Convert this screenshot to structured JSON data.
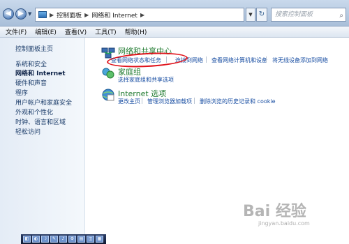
{
  "address": {
    "crumbs": [
      "控制面板",
      "网络和 Internet"
    ],
    "search_placeholder": "搜索控制面板"
  },
  "menu": [
    "文件(F)",
    "编辑(E)",
    "查看(V)",
    "工具(T)",
    "帮助(H)"
  ],
  "sidebar": {
    "items": [
      {
        "label": "控制面板主页",
        "active": false
      },
      {
        "label": "系统和安全",
        "active": false
      },
      {
        "label": "网络和 Internet",
        "active": true
      },
      {
        "label": "硬件和声音",
        "active": false
      },
      {
        "label": "程序",
        "active": false
      },
      {
        "label": "用户帐户和家庭安全",
        "active": false
      },
      {
        "label": "外观和个性化",
        "active": false
      },
      {
        "label": "时钟、语言和区域",
        "active": false
      },
      {
        "label": "轻松访问",
        "active": false
      }
    ]
  },
  "categories": [
    {
      "title": "网络和共享中心",
      "icon": "network-sharing-icon",
      "links": [
        "查看网络状态和任务",
        "连接到网络",
        "查看网络计算机和设备",
        "将无线设备添加到网络"
      ]
    },
    {
      "title": "家庭组",
      "icon": "homegroup-icon",
      "links": [
        "选择家庭组和共享选项"
      ]
    },
    {
      "title": "Internet 选项",
      "icon": "internet-options-icon",
      "links": [
        "更改主页",
        "管理浏览器加载项",
        "删除浏览的历史记录和 cookie"
      ]
    }
  ],
  "annotation": {
    "color": "#e0141c"
  },
  "watermark": {
    "text": "Bai 经验",
    "sub": "jingyan.baidu.com"
  },
  "colors": {
    "category_title": "#1e7a2e",
    "link": "#1a4fa3"
  }
}
